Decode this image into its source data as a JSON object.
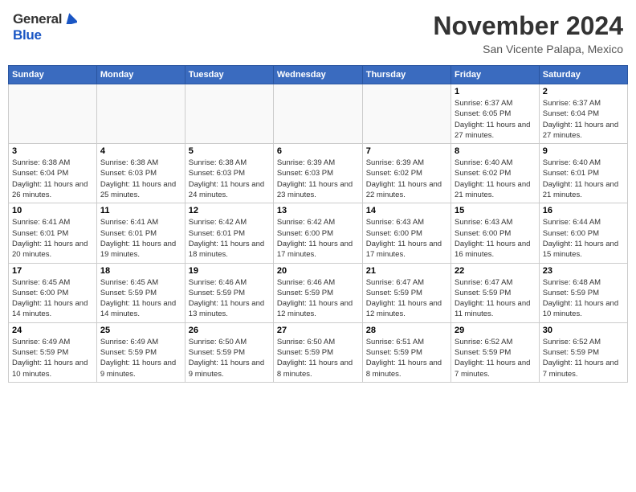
{
  "header": {
    "logo_general": "General",
    "logo_blue": "Blue",
    "month_title": "November 2024",
    "location": "San Vicente Palapa, Mexico"
  },
  "weekdays": [
    "Sunday",
    "Monday",
    "Tuesday",
    "Wednesday",
    "Thursday",
    "Friday",
    "Saturday"
  ],
  "weeks": [
    [
      {
        "day": "",
        "empty": true
      },
      {
        "day": "",
        "empty": true
      },
      {
        "day": "",
        "empty": true
      },
      {
        "day": "",
        "empty": true
      },
      {
        "day": "",
        "empty": true
      },
      {
        "day": "1",
        "sunrise": "6:37 AM",
        "sunset": "6:05 PM",
        "daylight": "11 hours and 27 minutes."
      },
      {
        "day": "2",
        "sunrise": "6:37 AM",
        "sunset": "6:04 PM",
        "daylight": "11 hours and 27 minutes."
      }
    ],
    [
      {
        "day": "3",
        "sunrise": "6:38 AM",
        "sunset": "6:04 PM",
        "daylight": "11 hours and 26 minutes."
      },
      {
        "day": "4",
        "sunrise": "6:38 AM",
        "sunset": "6:03 PM",
        "daylight": "11 hours and 25 minutes."
      },
      {
        "day": "5",
        "sunrise": "6:38 AM",
        "sunset": "6:03 PM",
        "daylight": "11 hours and 24 minutes."
      },
      {
        "day": "6",
        "sunrise": "6:39 AM",
        "sunset": "6:03 PM",
        "daylight": "11 hours and 23 minutes."
      },
      {
        "day": "7",
        "sunrise": "6:39 AM",
        "sunset": "6:02 PM",
        "daylight": "11 hours and 22 minutes."
      },
      {
        "day": "8",
        "sunrise": "6:40 AM",
        "sunset": "6:02 PM",
        "daylight": "11 hours and 21 minutes."
      },
      {
        "day": "9",
        "sunrise": "6:40 AM",
        "sunset": "6:01 PM",
        "daylight": "11 hours and 21 minutes."
      }
    ],
    [
      {
        "day": "10",
        "sunrise": "6:41 AM",
        "sunset": "6:01 PM",
        "daylight": "11 hours and 20 minutes."
      },
      {
        "day": "11",
        "sunrise": "6:41 AM",
        "sunset": "6:01 PM",
        "daylight": "11 hours and 19 minutes."
      },
      {
        "day": "12",
        "sunrise": "6:42 AM",
        "sunset": "6:01 PM",
        "daylight": "11 hours and 18 minutes."
      },
      {
        "day": "13",
        "sunrise": "6:42 AM",
        "sunset": "6:00 PM",
        "daylight": "11 hours and 17 minutes."
      },
      {
        "day": "14",
        "sunrise": "6:43 AM",
        "sunset": "6:00 PM",
        "daylight": "11 hours and 17 minutes."
      },
      {
        "day": "15",
        "sunrise": "6:43 AM",
        "sunset": "6:00 PM",
        "daylight": "11 hours and 16 minutes."
      },
      {
        "day": "16",
        "sunrise": "6:44 AM",
        "sunset": "6:00 PM",
        "daylight": "11 hours and 15 minutes."
      }
    ],
    [
      {
        "day": "17",
        "sunrise": "6:45 AM",
        "sunset": "6:00 PM",
        "daylight": "11 hours and 14 minutes."
      },
      {
        "day": "18",
        "sunrise": "6:45 AM",
        "sunset": "5:59 PM",
        "daylight": "11 hours and 14 minutes."
      },
      {
        "day": "19",
        "sunrise": "6:46 AM",
        "sunset": "5:59 PM",
        "daylight": "11 hours and 13 minutes."
      },
      {
        "day": "20",
        "sunrise": "6:46 AM",
        "sunset": "5:59 PM",
        "daylight": "11 hours and 12 minutes."
      },
      {
        "day": "21",
        "sunrise": "6:47 AM",
        "sunset": "5:59 PM",
        "daylight": "11 hours and 12 minutes."
      },
      {
        "day": "22",
        "sunrise": "6:47 AM",
        "sunset": "5:59 PM",
        "daylight": "11 hours and 11 minutes."
      },
      {
        "day": "23",
        "sunrise": "6:48 AM",
        "sunset": "5:59 PM",
        "daylight": "11 hours and 10 minutes."
      }
    ],
    [
      {
        "day": "24",
        "sunrise": "6:49 AM",
        "sunset": "5:59 PM",
        "daylight": "11 hours and 10 minutes."
      },
      {
        "day": "25",
        "sunrise": "6:49 AM",
        "sunset": "5:59 PM",
        "daylight": "11 hours and 9 minutes."
      },
      {
        "day": "26",
        "sunrise": "6:50 AM",
        "sunset": "5:59 PM",
        "daylight": "11 hours and 9 minutes."
      },
      {
        "day": "27",
        "sunrise": "6:50 AM",
        "sunset": "5:59 PM",
        "daylight": "11 hours and 8 minutes."
      },
      {
        "day": "28",
        "sunrise": "6:51 AM",
        "sunset": "5:59 PM",
        "daylight": "11 hours and 8 minutes."
      },
      {
        "day": "29",
        "sunrise": "6:52 AM",
        "sunset": "5:59 PM",
        "daylight": "11 hours and 7 minutes."
      },
      {
        "day": "30",
        "sunrise": "6:52 AM",
        "sunset": "5:59 PM",
        "daylight": "11 hours and 7 minutes."
      }
    ]
  ]
}
